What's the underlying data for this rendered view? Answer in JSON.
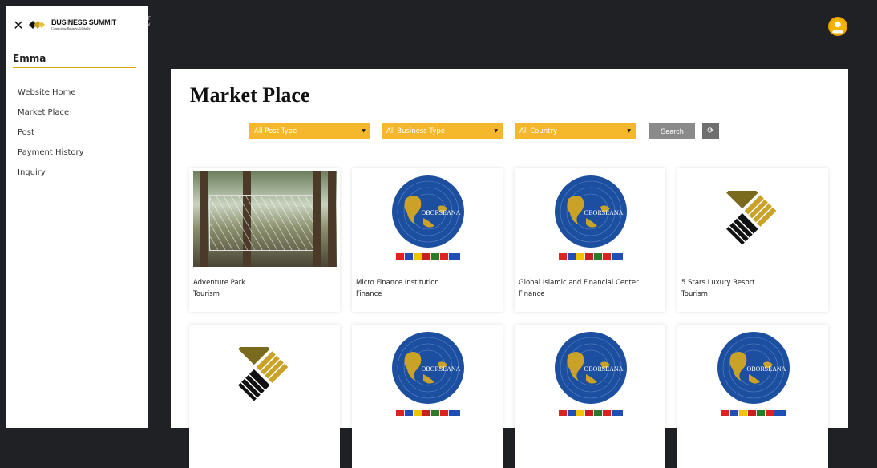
{
  "sidebar": {
    "brand_title": "BUSINESS SUMMIT",
    "brand_sub": "Connecting Business Globally",
    "user": "Emma",
    "items": [
      {
        "label": "Website Home"
      },
      {
        "label": "Market Place"
      },
      {
        "label": "Post"
      },
      {
        "label": "Payment History"
      },
      {
        "label": "Inquiry"
      }
    ]
  },
  "header": {
    "ghost_text": "T\nv"
  },
  "main": {
    "title": "Market Place",
    "filters": {
      "post_type": "All Post Type",
      "business_type": "All Business Type",
      "country": "All Country",
      "search_label": "Search"
    },
    "cards": [
      {
        "name": "Adventure Park",
        "type": "Tourism",
        "image": "photo"
      },
      {
        "name": "Micro Finance Institution",
        "type": "Finance",
        "image": "oborseana-logo"
      },
      {
        "name": "Global Islamic and Financial Center",
        "type": "Finance",
        "image": "oborseana-logo"
      },
      {
        "name": "5 Stars Luxury Resort",
        "type": "Tourism",
        "image": "summit-logo"
      },
      {
        "name": "",
        "type": "",
        "image": "summit-logo"
      },
      {
        "name": "",
        "type": "",
        "image": "oborseana-logo"
      },
      {
        "name": "",
        "type": "",
        "image": "oborseana-logo"
      },
      {
        "name": "",
        "type": "",
        "image": "oborseana-logo"
      }
    ],
    "logo_text": "OBORSEANA"
  },
  "colors": {
    "accent": "#f5b72b",
    "dark": "#1f2124",
    "logo_blue": "#1c4fa0"
  }
}
